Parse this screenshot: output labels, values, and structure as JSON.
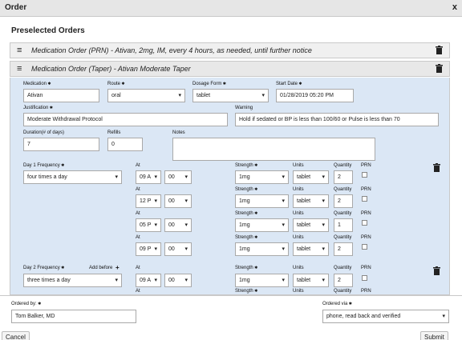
{
  "window": {
    "title": "Order",
    "close_label": "x"
  },
  "heading": "Preselected Orders",
  "orders": [
    {
      "text": "Medication Order (PRN) - Ativan, 2mg, IM, every 4 hours, as needed, until further notice"
    },
    {
      "text": "Medication Order (Taper) - Ativan Moderate Taper"
    }
  ],
  "form": {
    "medication": {
      "label": "Medication",
      "value": "Ativan"
    },
    "route": {
      "label": "Route",
      "value": "oral"
    },
    "dosage_form": {
      "label": "Dosage Form",
      "value": "tablet"
    },
    "start_date": {
      "label": "Start Date",
      "value": "01/28/2019 05:20 PM"
    },
    "justification": {
      "label": "Justification",
      "value": "Moderate Withdrawal Protocol"
    },
    "warning": {
      "label": "Warning",
      "value": "Hold if sedated or BP is less than 100/60 or Pulse is less than 70"
    },
    "duration": {
      "label": "Duration(# of days)",
      "value": "7"
    },
    "refills": {
      "label": "Refills",
      "value": "0"
    },
    "notes": {
      "label": "Notes",
      "value": ""
    }
  },
  "day1": {
    "label": "Day 1 Frequency",
    "frequency": "four times a day",
    "rows": [
      {
        "at_label": "At",
        "hour": "09 A",
        "minute": "00",
        "strength_label": "Strength",
        "strength": "1mg",
        "units_label": "Units",
        "units": "tablet",
        "quantity_label": "Quantity",
        "quantity": "2",
        "prn_label": "PRN"
      },
      {
        "at_label": "At",
        "hour": "12 P",
        "minute": "00",
        "strength_label": "Strength",
        "strength": "1mg",
        "units_label": "Units",
        "units": "tablet",
        "quantity_label": "Quantity",
        "quantity": "2",
        "prn_label": "PRN"
      },
      {
        "at_label": "At",
        "hour": "05 P",
        "minute": "00",
        "strength_label": "Strength",
        "strength": "1mg",
        "units_label": "Units",
        "units": "tablet",
        "quantity_label": "Quantity",
        "quantity": "1",
        "prn_label": "PRN"
      },
      {
        "at_label": "At",
        "hour": "09 P",
        "minute": "00",
        "strength_label": "Strength",
        "strength": "1mg",
        "units_label": "Units",
        "units": "tablet",
        "quantity_label": "Quantity",
        "quantity": "2",
        "prn_label": "PRN"
      }
    ]
  },
  "day2": {
    "label": "Day 2 Frequency",
    "add_before": "Add before",
    "frequency": "three times a day",
    "rows": [
      {
        "at_label": "At",
        "hour": "09 A",
        "minute": "00",
        "strength_label": "Strength",
        "strength": "1mg",
        "units_label": "Units",
        "units": "tablet",
        "quantity_label": "Quantity",
        "quantity": "2",
        "prn_label": "PRN"
      }
    ],
    "next_at_label": "At",
    "next_strength_label": "Strength",
    "next_units_label": "Units",
    "next_quantity_label": "Quantity",
    "next_prn_label": "PRN"
  },
  "footer": {
    "ordered_by": {
      "label": "Ordered by:",
      "value": "Tom Balker, MD"
    },
    "ordered_via": {
      "label": "Ordered via",
      "value": "phone, read back and verified"
    },
    "cancel_label": "Cancel",
    "submit_label": "Submit"
  }
}
